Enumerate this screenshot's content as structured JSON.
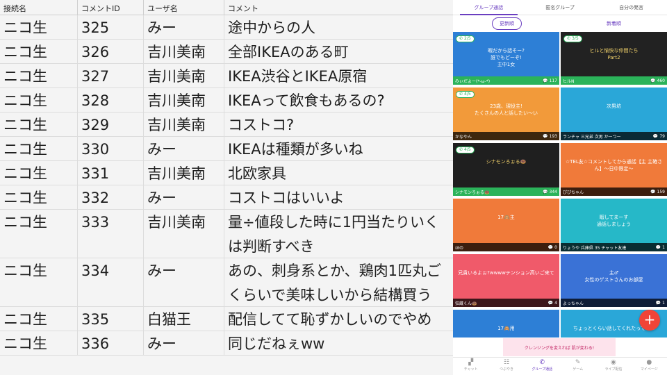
{
  "table": {
    "headers": [
      "接続名",
      "コメントID",
      "ユーザ名",
      "コメント"
    ],
    "rows": [
      {
        "conn": "ニコ生",
        "id": "325",
        "user": "みー",
        "comment": "途中からの人"
      },
      {
        "conn": "ニコ生",
        "id": "326",
        "user": "吉川美南",
        "comment": "全部IKEAのある町"
      },
      {
        "conn": "ニコ生",
        "id": "327",
        "user": "吉川美南",
        "comment": "IKEA渋谷とIKEA原宿"
      },
      {
        "conn": "ニコ生",
        "id": "328",
        "user": "吉川美南",
        "comment": "IKEAって飲食もあるの?"
      },
      {
        "conn": "ニコ生",
        "id": "329",
        "user": "吉川美南",
        "comment": "コストコ?"
      },
      {
        "conn": "ニコ生",
        "id": "330",
        "user": "みー",
        "comment": "IKEAは種類が多いね"
      },
      {
        "conn": "ニコ生",
        "id": "331",
        "user": "吉川美南",
        "comment": "北欧家具"
      },
      {
        "conn": "ニコ生",
        "id": "332",
        "user": "みー",
        "comment": "コストコはいいよ"
      },
      {
        "conn": "ニコ生",
        "id": "333",
        "user": "吉川美南",
        "comment": "量÷値段した時に1円当たりいく",
        "comment2": "は判断すべき"
      },
      {
        "conn": "ニコ生",
        "id": "334",
        "user": "みー",
        "comment": "あの、刺身系とか、鶏肉1匹丸ご",
        "comment2": "くらいで美味しいから結構買う"
      },
      {
        "conn": "ニコ生",
        "id": "335",
        "user": "白猫王",
        "comment": "配信してて恥ずかしいのでやめ"
      },
      {
        "conn": "ニコ生",
        "id": "336",
        "user": "みー",
        "comment": "同じだねぇww"
      }
    ]
  },
  "app": {
    "tabs": [
      "グループ通話",
      "匿名グループ",
      "自分の発言"
    ],
    "sort": [
      "更新順",
      "新着順"
    ],
    "cards": [
      {
        "bg": "#2d7fd6",
        "text_color": "#ffffff",
        "badge": "2/5",
        "title": "暇だから話そー?\n誰でもどーぞ!\n主中1女",
        "footer_bg": "green",
        "name": "みぃだよー(*-ω-*)",
        "count": "117"
      },
      {
        "bg": "#222222",
        "text_color": "#f3d36b",
        "badge": "3/5",
        "title": "ヒルと愉快な仲間たち\nPart2",
        "footer_bg": "green",
        "name": "ヒルN",
        "count": "460"
      },
      {
        "bg": "#f29a3a",
        "text_color": "#ffffff",
        "badge": "4/5",
        "title": "23歳、現役主!\nたくさんの人と話したい〜い",
        "footer_bg": "dark",
        "name": "かなやん",
        "count": "193"
      },
      {
        "bg": "#2aa7d8",
        "text_color": "#ffffff",
        "badge": "",
        "title": "次男坊",
        "footer_bg": "dark",
        "name": "ランチャ 三兄弟 次男 かーつー",
        "count": "79"
      },
      {
        "bg": "#1f1f1f",
        "text_color": "#f3d36b",
        "badge": "4/5",
        "title": "シナモンろぉる🍩",
        "footer_bg": "green",
        "name": "シナモンろぉる🍩",
        "count": "344"
      },
      {
        "bg": "#f07a3a",
        "text_color": "#ffffff",
        "badge": "",
        "title": "☆TEL友☆コメントしてから通話【主 主確さ\nん】〜日中限定〜",
        "footer_bg": "dark",
        "name": "ぴぴちゃん",
        "count": "159"
      },
      {
        "bg": "#f07a3a",
        "text_color": "#ffffff",
        "badge": "",
        "title": "17🙈主",
        "footer_bg": "dark",
        "name": "ほの",
        "count": "0"
      },
      {
        "bg": "#26b8c8",
        "text_color": "#ffffff",
        "badge": "",
        "title": "暇してまーす\n通話しましょう",
        "footer_bg": "dark",
        "name": "りょうや 兵庫県 35 チャット友達",
        "count": "1"
      },
      {
        "bg": "#f05a6a",
        "text_color": "#ffffff",
        "badge": "",
        "title": "兄貴いるよぉ?wwwwテンション高いご来て",
        "footer_bg": "dark",
        "name": "狂蔵くん🍩",
        "count": "4"
      },
      {
        "bg": "#3a72d6",
        "text_color": "#ffffff",
        "badge": "",
        "title": "主♂\n女性のゲストさんのお部屋",
        "footer_bg": "dark",
        "name": "よっちゃん",
        "count": "1"
      },
      {
        "bg": "#2d7fd6",
        "text_color": "#ffffff",
        "badge": "",
        "title": "17🙈用",
        "footer_bg": "dark",
        "name": "",
        "count": ""
      },
      {
        "bg": "#2aa7d8",
        "text_color": "#ffffff",
        "badge": "",
        "title": "ちょっとくらい話してくれたっても...",
        "footer_bg": "dark",
        "name": "",
        "count": ""
      }
    ],
    "ad_text": "クレンジングを変えれば 肌が変わる!",
    "fab": "+",
    "nav": [
      {
        "icon": "chat-icon",
        "glyph": "▞",
        "label": "チャット"
      },
      {
        "icon": "timeline-icon",
        "glyph": "☷",
        "label": "つぶやき"
      },
      {
        "icon": "phone-icon",
        "glyph": "✆",
        "label": "グループ通話"
      },
      {
        "icon": "pencil-icon",
        "glyph": "✎",
        "label": "ゲーム"
      },
      {
        "icon": "broadcast-icon",
        "glyph": "◉",
        "label": "ライブ配信"
      },
      {
        "icon": "person-icon",
        "glyph": "●",
        "label": "マイページ"
      }
    ]
  },
  "colors": {
    "accent": "#6a3ec0",
    "fab": "#f04438",
    "badge_green": "#2bb35a"
  }
}
